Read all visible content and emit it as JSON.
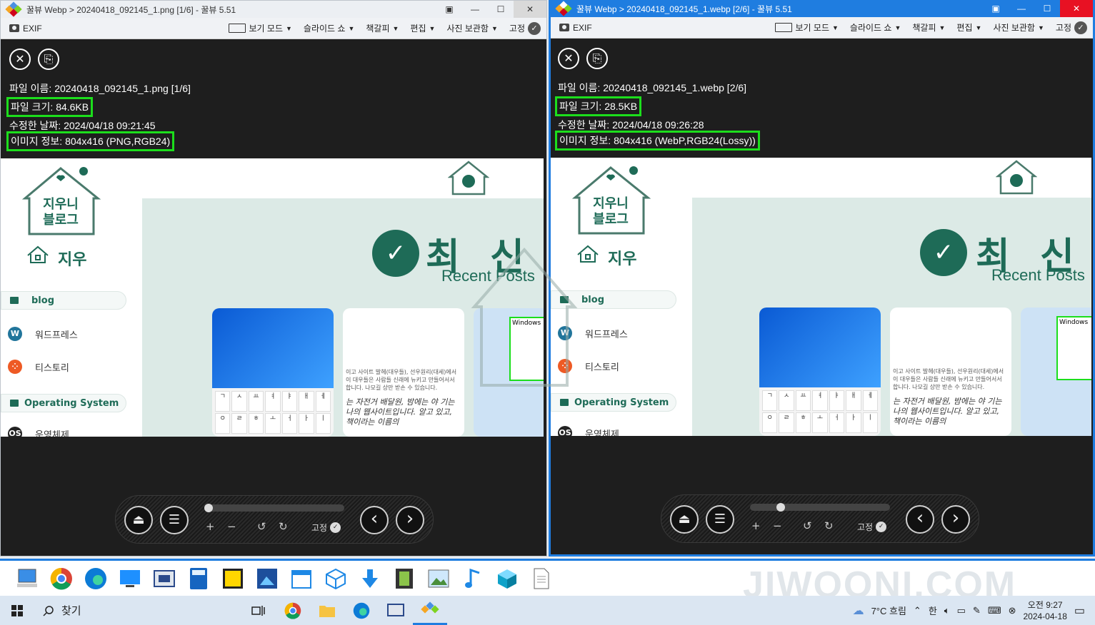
{
  "windows": [
    {
      "id": "left",
      "title": "꿀뷰 Webp > 20240418_092145_1.png [1/6] - 꿀뷰 5.51",
      "file_name": "파일 이름: 20240418_092145_1.png [1/6]",
      "file_size": "파일 크기: 84.6KB",
      "modified": "수정한 날짜: 2024/04/18 09:21:45",
      "image_info": "이미지 정보: 804x416 (PNG,RGB24)",
      "slider_position": 0.0
    },
    {
      "id": "right",
      "title": "꿀뷰 Webp > 20240418_092145_1.webp [2/6] - 꿀뷰 5.51",
      "file_name": "파일 이름: 20240418_092145_1.webp [2/6]",
      "file_size": "파일 크기: 28.5KB",
      "modified": "수정한 날짜: 2024/04/18 09:26:28",
      "image_info": "이미지 정보: 804x416 (WebP,RGB24(Lossy))",
      "slider_position": 0.2
    }
  ],
  "toolbar": {
    "exif": "EXIF",
    "view_mode": "보기 모드",
    "slideshow": "슬라이드 쇼",
    "bookmark": "책갈피",
    "edit": "편집",
    "photo_storage": "사진 보관함",
    "pin": "고정"
  },
  "window_buttons": {
    "restore": "▣",
    "minimize": "—",
    "maximize": "☐",
    "close": "✕"
  },
  "viewer_buttons": {
    "close": "✕",
    "copy": "⎘"
  },
  "control_bar": {
    "eject": "⏏",
    "menu": "☰",
    "zoom_in": "+",
    "zoom_out": "−",
    "rotate_left": "↺",
    "rotate_right": "↻",
    "pin": "고정",
    "prev": "‹",
    "next": "›"
  },
  "image_content": {
    "logo_line1": "지우니",
    "logo_line2": "블로그",
    "brand": "지우",
    "nav_blog": "blog",
    "link_wordpress": "워드프레스",
    "link_tistory": "티스토리",
    "nav_os": "Operating System",
    "link_os": "운영체제",
    "headline": "최 신 글",
    "subheadline": "Recent Posts",
    "card_text_1": "이고 사이트 발헤(대우들), 선우원리(대세)에서 이 대우들은 사람들 신래에 뉴키고 만들어서서 합니다. 나모길 상만 받손 수 있습니다.",
    "card_text_2": "는 자전거 배달원, 밤에는 야 기는 나의 웹사이트입니다. 알고 있고, 책이라는 이름의",
    "card_keys": [
      "ㄱ",
      "ㅅ",
      "ㅛ",
      "ㅕ",
      "ㅑ",
      "ㅐ",
      "ㅔ",
      "ㅇ",
      "ㄹ",
      "ㅎ",
      "ㅗ",
      "ㅓ",
      "ㅏ",
      "ㅣ"
    ],
    "windows_label": "Windows"
  },
  "taskbar": {
    "search_placeholder": "찾기",
    "weather": "7°C 흐림",
    "ime": "한",
    "time": "오전 9:27",
    "date": "2024-04-18"
  },
  "watermark": "JIWOONI.COM",
  "colors": {
    "accent_green": "#1cde1c",
    "brand_green": "#1e6b57",
    "active_title": "#1f7de0"
  }
}
